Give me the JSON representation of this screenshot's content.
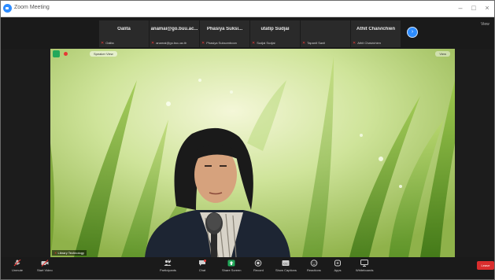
{
  "window": {
    "title": "Zoom Meeting",
    "controls": [
      "–",
      "□",
      "×"
    ]
  },
  "strip": {
    "tiles": [
      {
        "big": "Oalita",
        "small": "Oalita"
      },
      {
        "big": "anamai@go.buu.ac...",
        "small": "anamai@go.buu.ac.th"
      },
      {
        "big": "Phasiya Suksi...",
        "small": "Phasiya Suksomboon"
      },
      {
        "big": "utatip Sudjai",
        "small": "Sudjai Sudjai"
      },
      {
        "big": "",
        "small": "Tapanit Sanit"
      },
      {
        "big": "Athit Chaivichien",
        "small": "Athit Chaivichien"
      }
    ],
    "next_label": "›",
    "view_label": "View"
  },
  "main_video": {
    "speaker_pill": "Speaker View",
    "view_pill": "View",
    "name_badge": "Library Technology"
  },
  "toolbar": {
    "items": [
      {
        "id": "unmute",
        "label": "Unmute"
      },
      {
        "id": "startvideo",
        "label": "Start Video"
      },
      {
        "id": "participants",
        "label": "Participants",
        "count": "34"
      },
      {
        "id": "chat",
        "label": "Chat"
      },
      {
        "id": "share",
        "label": "Share Screen"
      },
      {
        "id": "record",
        "label": "Record"
      },
      {
        "id": "captions",
        "label": "Show Captions"
      },
      {
        "id": "reactions",
        "label": "Reactions"
      },
      {
        "id": "apps",
        "label": "Apps"
      },
      {
        "id": "whiteboards",
        "label": "Whiteboards"
      }
    ],
    "leave": "Leave"
  },
  "colors": {
    "accent": "#2d8cff",
    "leave": "#d92d2d",
    "share": "#23a85a",
    "mic_off": "#e53935"
  }
}
